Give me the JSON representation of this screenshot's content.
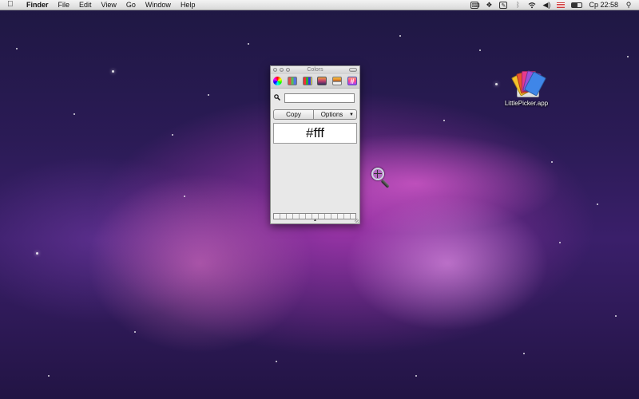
{
  "menubar": {
    "app_name": "Finder",
    "menus": [
      "File",
      "Edit",
      "View",
      "Go",
      "Window",
      "Help"
    ],
    "clock": "Cp 22:58",
    "status_icons": [
      "keyboard-icon",
      "dropbox-icon",
      "notes-icon",
      "bluetooth-icon",
      "wifi-icon",
      "volume-icon",
      "flag-icon",
      "battery-icon",
      "spotlight-icon"
    ]
  },
  "colors_panel": {
    "title": "Colors",
    "toolbar_icons": [
      "color-wheel-icon",
      "color-sliders-icon",
      "color-palettes-icon",
      "image-palettes-icon",
      "crayons-icon",
      "littlepicker-hash-icon"
    ],
    "search_value": "",
    "copy_label": "Copy",
    "options_label": "Options",
    "hex_value": "#fff"
  },
  "desktop_icons": [
    {
      "label": "LittlePicker.app"
    }
  ]
}
